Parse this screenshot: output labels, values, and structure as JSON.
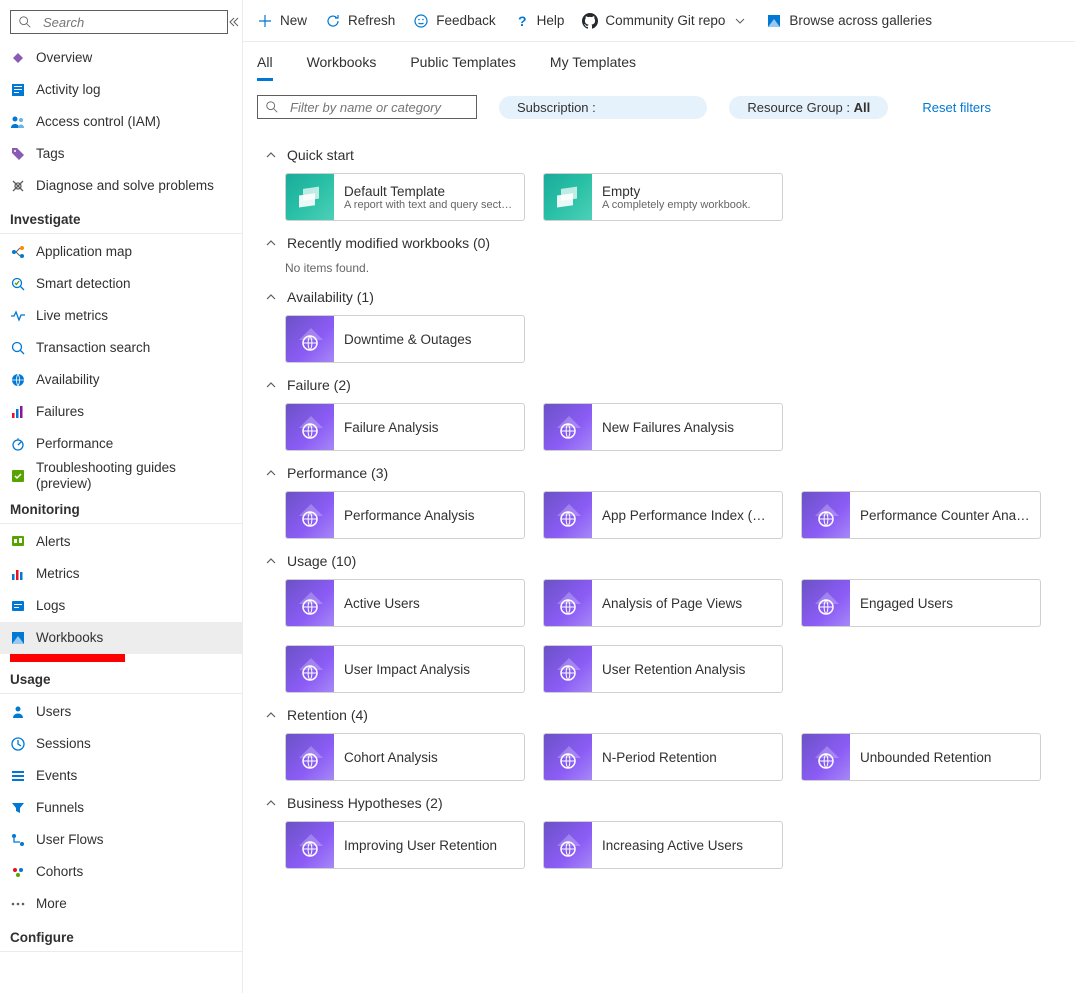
{
  "search": {
    "placeholder": "Search"
  },
  "nav": {
    "top": [
      {
        "label": "Overview",
        "icon": "overview"
      },
      {
        "label": "Activity log",
        "icon": "activity-log"
      },
      {
        "label": "Access control (IAM)",
        "icon": "access-control"
      },
      {
        "label": "Tags",
        "icon": "tags"
      },
      {
        "label": "Diagnose and solve problems",
        "icon": "diagnose"
      }
    ],
    "sections": [
      {
        "header": "Investigate",
        "items": [
          {
            "label": "Application map",
            "icon": "app-map"
          },
          {
            "label": "Smart detection",
            "icon": "smart-detection"
          },
          {
            "label": "Live metrics",
            "icon": "live-metrics"
          },
          {
            "label": "Transaction search",
            "icon": "transaction-search"
          },
          {
            "label": "Availability",
            "icon": "availability"
          },
          {
            "label": "Failures",
            "icon": "failures"
          },
          {
            "label": "Performance",
            "icon": "performance"
          },
          {
            "label": "Troubleshooting guides (preview)",
            "icon": "troubleshooting"
          }
        ]
      },
      {
        "header": "Monitoring",
        "items": [
          {
            "label": "Alerts",
            "icon": "alerts"
          },
          {
            "label": "Metrics",
            "icon": "metrics"
          },
          {
            "label": "Logs",
            "icon": "logs"
          },
          {
            "label": "Workbooks",
            "icon": "workbooks",
            "selected": true
          }
        ]
      },
      {
        "header": "Usage",
        "items": [
          {
            "label": "Users",
            "icon": "users"
          },
          {
            "label": "Sessions",
            "icon": "sessions"
          },
          {
            "label": "Events",
            "icon": "events"
          },
          {
            "label": "Funnels",
            "icon": "funnels"
          },
          {
            "label": "User Flows",
            "icon": "user-flows"
          },
          {
            "label": "Cohorts",
            "icon": "cohorts"
          },
          {
            "label": "More",
            "icon": "more"
          }
        ]
      },
      {
        "header": "Configure",
        "items": []
      }
    ]
  },
  "toolbar": {
    "new": "New",
    "refresh": "Refresh",
    "feedback": "Feedback",
    "help": "Help",
    "git": "Community Git repo",
    "browse": "Browse across galleries"
  },
  "tabs": {
    "all": "All",
    "workbooks": "Workbooks",
    "public": "Public Templates",
    "my": "My Templates"
  },
  "filters": {
    "placeholder": "Filter by name or category",
    "subscription_label": "Subscription :",
    "rg_label": "Resource Group : ",
    "rg_value": "All",
    "reset": "Reset filters"
  },
  "groups": [
    {
      "header": "Quick start",
      "cards": [
        {
          "title": "Default Template",
          "sub": "A report with text and query sections.",
          "tile": "green"
        },
        {
          "title": "Empty",
          "sub": "A completely empty workbook.",
          "tile": "green"
        }
      ]
    },
    {
      "header": "Recently modified workbooks (0)",
      "empty": "No items found.",
      "cards": []
    },
    {
      "header": "Availability (1)",
      "cards": [
        {
          "title": "Downtime & Outages",
          "tile": "purple"
        }
      ]
    },
    {
      "header": "Failure (2)",
      "cards": [
        {
          "title": "Failure Analysis",
          "tile": "purple"
        },
        {
          "title": "New Failures Analysis",
          "tile": "purple"
        }
      ]
    },
    {
      "header": "Performance (3)",
      "cards": [
        {
          "title": "Performance Analysis",
          "tile": "purple"
        },
        {
          "title": "App Performance Index (A...",
          "tile": "purple"
        },
        {
          "title": "Performance Counter Anal...",
          "tile": "purple"
        }
      ]
    },
    {
      "header": "Usage (10)",
      "cards": [
        {
          "title": "Active Users",
          "tile": "purple"
        },
        {
          "title": "Analysis of Page Views",
          "tile": "purple"
        },
        {
          "title": "Engaged Users",
          "tile": "purple"
        },
        {
          "title": "User Impact Analysis",
          "tile": "purple"
        },
        {
          "title": "User Retention Analysis",
          "tile": "purple"
        }
      ]
    },
    {
      "header": "Retention (4)",
      "cards": [
        {
          "title": "Cohort Analysis",
          "tile": "purple"
        },
        {
          "title": "N-Period Retention",
          "tile": "purple"
        },
        {
          "title": "Unbounded Retention",
          "tile": "purple"
        }
      ]
    },
    {
      "header": "Business Hypotheses (2)",
      "cards": [
        {
          "title": "Improving User Retention",
          "tile": "purple"
        },
        {
          "title": "Increasing Active Users",
          "tile": "purple"
        }
      ]
    }
  ]
}
